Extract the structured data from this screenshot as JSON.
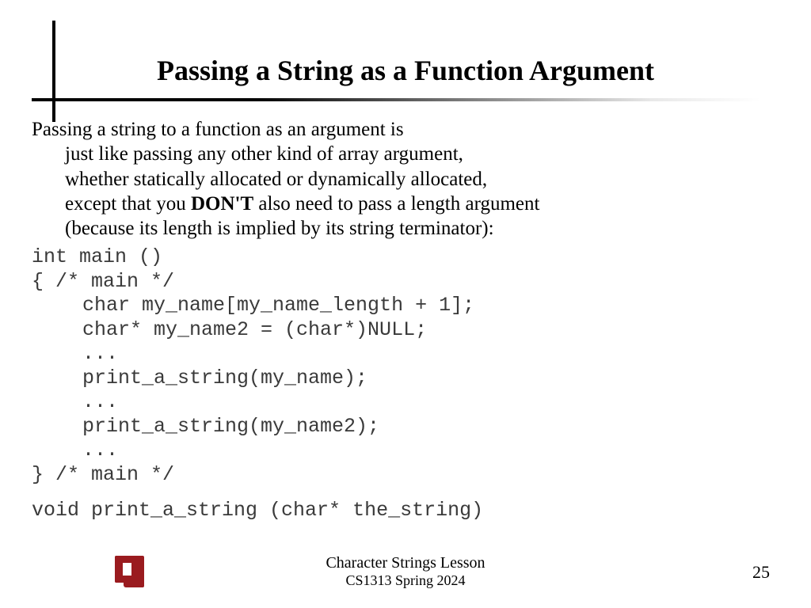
{
  "slide": {
    "title": "Passing a String as a Function Argument",
    "para": {
      "l1": "Passing a string to a function as an argument is",
      "l2": "just like passing  any other kind of array argument,",
      "l3": "whether statically allocated or dynamically allocated,",
      "l4a": "except that you  ",
      "l4b": "DON'T",
      "l4c": " also need to pass a length argument",
      "l5": "(because its length is implied by its string terminator):"
    },
    "code": {
      "c1": "int main ()",
      "c2": "{ /* main */",
      "c3": "char my_name[my_name_length + 1];",
      "c4": "char* my_name2 = (char*)NULL;",
      "c5": "...",
      "c6": "print_a_string(my_name);",
      "c7": "...",
      "c8": "print_a_string(my_name2);",
      "c9": "...",
      "c10": "} /* main */",
      "decl": "void print_a_string (char* the_string)"
    }
  },
  "footer": {
    "lesson": "Character Strings Lesson",
    "course": "CS1313 Spring 2024",
    "page": "25",
    "logo_name": "ou-logo"
  }
}
